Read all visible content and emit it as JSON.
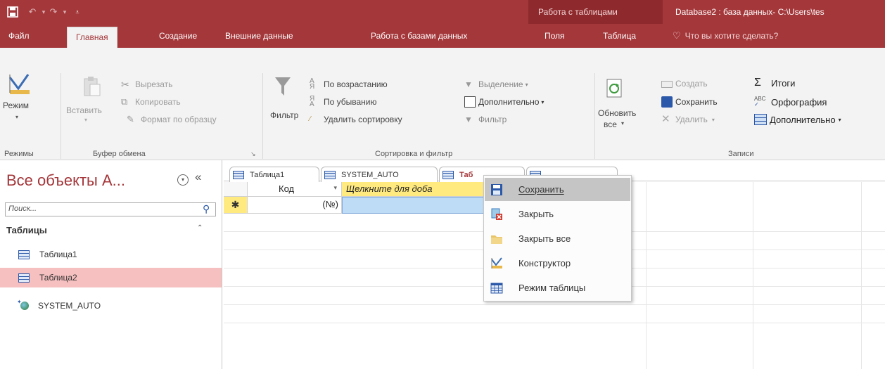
{
  "titlebar": {
    "context_title": "Работа с таблицами",
    "doc_title": "Database2 : база данных- C:\\Users\\tes"
  },
  "tabs": [
    {
      "label": "Файл"
    },
    {
      "label": "Главная"
    },
    {
      "label": "Создание"
    },
    {
      "label": "Внешние данные"
    },
    {
      "label": "Работа с базами данных"
    },
    {
      "label": "Поля"
    },
    {
      "label": "Таблица"
    }
  ],
  "tellme": "Что вы хотите сделать?",
  "ribbon": {
    "views": {
      "button": "Режим",
      "group": "Режимы"
    },
    "clipboard": {
      "paste": "Вставить",
      "cut": "Вырезать",
      "copy": "Копировать",
      "format_painter": "Формат по образцу",
      "group": "Буфер обмена"
    },
    "sort_filter": {
      "filter": "Фильтр",
      "ascending": "По возрастанию",
      "descending": "По убыванию",
      "remove_sort": "Удалить сортировку",
      "selection": "Выделение",
      "advanced": "Дополнительно",
      "toggle_filter": "Фильтр",
      "group": "Сортировка и фильтр"
    },
    "records": {
      "refresh_line1": "Обновить",
      "refresh_line2": "все",
      "new": "Создать",
      "save": "Сохранить",
      "delete": "Удалить",
      "totals": "Итоги",
      "spelling": "Орфография",
      "more": "Дополнительно",
      "group": "Записи"
    }
  },
  "nav": {
    "title": "Все объекты A...",
    "search_placeholder": "Поиск...",
    "section": "Таблицы",
    "items": [
      {
        "label": "Таблица1",
        "selected": false
      },
      {
        "label": "Таблица2",
        "selected": true
      },
      {
        "label": "SYSTEM_AUTO",
        "selected": false
      }
    ]
  },
  "doc_tabs": [
    {
      "label": "Таблица1"
    },
    {
      "label": "SYSTEM_AUTO"
    },
    {
      "label": "Таб"
    }
  ],
  "grid": {
    "columns": [
      "Код",
      "Щелкните для доба"
    ],
    "new_row_value": "(№)"
  },
  "context_menu": {
    "items": [
      {
        "label": "Сохранить",
        "icon": "save-icon",
        "highlighted": true
      },
      {
        "label": "Закрыть",
        "icon": "close-doc-icon",
        "highlighted": false
      },
      {
        "label": "Закрыть все",
        "icon": "folder-icon",
        "highlighted": false
      },
      {
        "label": "Конструктор",
        "icon": "design-view-icon",
        "highlighted": false
      },
      {
        "label": "Режим таблицы",
        "icon": "datasheet-icon",
        "highlighted": false
      }
    ]
  },
  "colors": {
    "brand": "#a4373a",
    "context_header": "#8e2a2d",
    "nav_selected": "#f7c0c0",
    "menu_highlight": "#c5c5c5",
    "active_cell": "#bfdcf7",
    "column_header_yellow": "#ffea80"
  }
}
